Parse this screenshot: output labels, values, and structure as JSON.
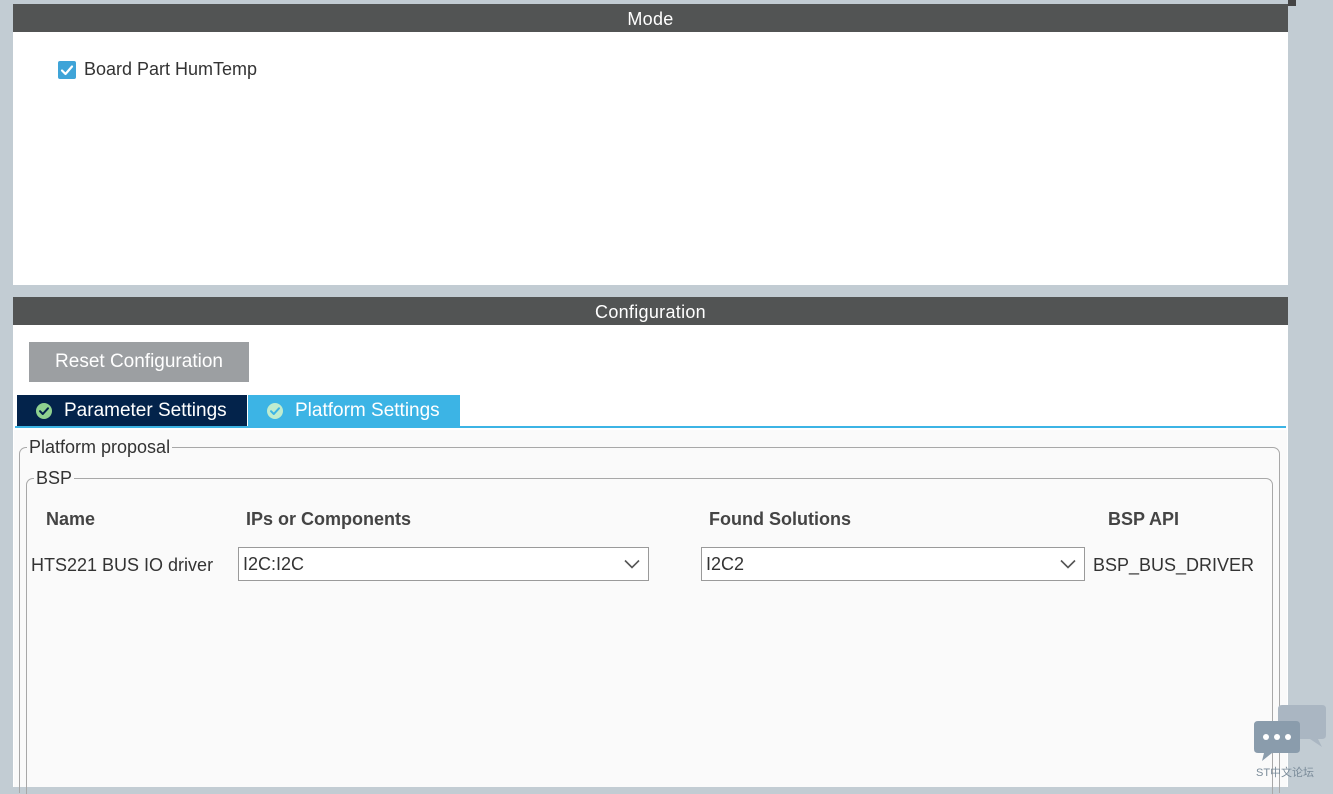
{
  "mode": {
    "header": "Mode",
    "checkbox_label": "Board Part HumTemp",
    "checkbox_checked": true
  },
  "configuration": {
    "header": "Configuration",
    "reset_button": "Reset Configuration",
    "tabs": [
      {
        "label": "Parameter Settings",
        "active": false,
        "icon": "check-circle-icon"
      },
      {
        "label": "Platform Settings",
        "active": true,
        "icon": "check-circle-icon"
      }
    ],
    "platform_proposal_legend": "Platform proposal",
    "bsp_legend": "BSP",
    "columns": [
      "Name",
      "IPs or Components",
      "Found Solutions",
      "BSP API"
    ],
    "rows": [
      {
        "name": "HTS221 BUS IO driver",
        "ips": "I2C:I2C",
        "found": "I2C2",
        "bsp_api": "BSP_BUS_DRIVER"
      }
    ]
  },
  "watermark": {
    "caption": "ST中文论坛",
    "icon": "chat-bubble-icon"
  },
  "colors": {
    "header_bg": "#525454",
    "tab_dark": "#03234b",
    "tab_accent": "#3cb4e5",
    "checkbox": "#3fa4d8",
    "button_bg": "#9c9fa2"
  }
}
